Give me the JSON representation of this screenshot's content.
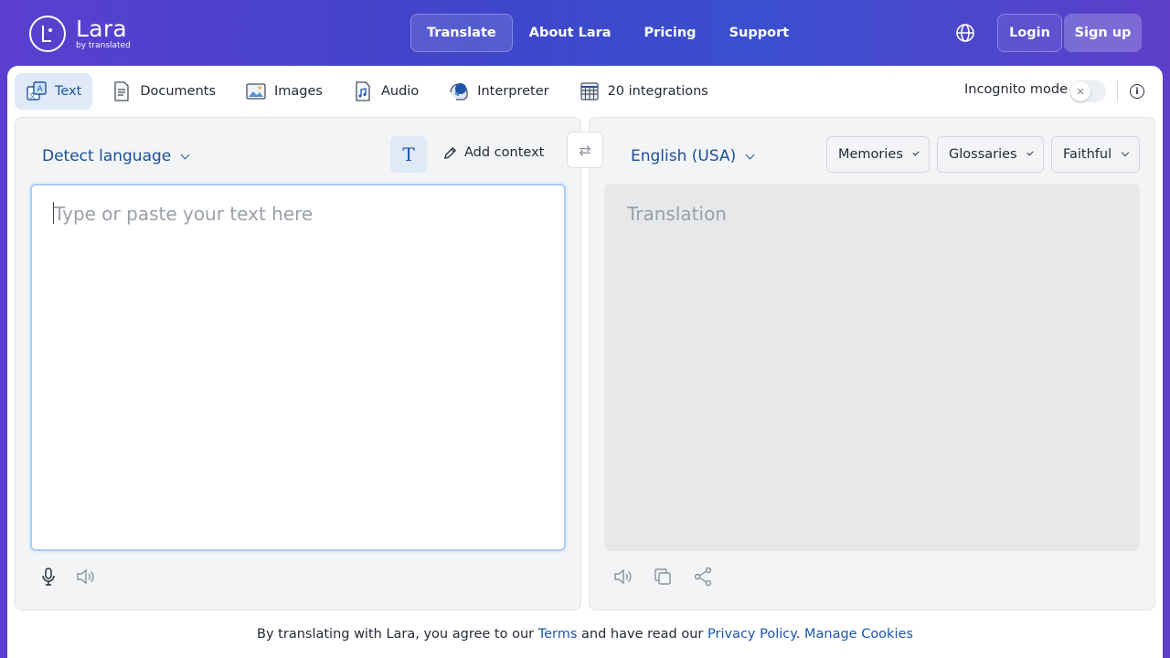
{
  "header": {
    "logo": {
      "name": "Lara",
      "sub": "by translated"
    },
    "nav": [
      {
        "label": "Translate",
        "active": true
      },
      {
        "label": "About Lara",
        "active": false
      },
      {
        "label": "Pricing",
        "active": false
      },
      {
        "label": "Support",
        "active": false
      }
    ],
    "login_label": "Login",
    "signup_label": "Sign up"
  },
  "tabs": [
    {
      "label": "Text",
      "icon": "text-translate-icon",
      "active": true
    },
    {
      "label": "Documents",
      "icon": "document-icon",
      "active": false
    },
    {
      "label": "Images",
      "icon": "image-icon",
      "active": false
    },
    {
      "label": "Audio",
      "icon": "audio-file-icon",
      "active": false
    },
    {
      "label": "Interpreter",
      "icon": "interpreter-icon",
      "active": false
    },
    {
      "label": "20 integrations",
      "icon": "integrations-grid-icon",
      "active": false
    }
  ],
  "incognito": {
    "label": "Incognito mode",
    "enabled": false
  },
  "source": {
    "language": "Detect language",
    "add_context_label": "Add context",
    "placeholder": "Type or paste your text here"
  },
  "target": {
    "language": "English (USA)",
    "placeholder": "Translation",
    "memories_label": "Memories",
    "glossaries_label": "Glossaries",
    "style_label": "Faithful"
  },
  "footer": {
    "prefix": "By translating with Lara, you agree to our ",
    "terms": "Terms",
    "middle": " and have read our ",
    "privacy": "Privacy Policy",
    "dot": ". ",
    "cookies": "Manage Cookies"
  },
  "colors": {
    "accent": "#1a4f9c",
    "link": "#1a56b0",
    "header_bg": "#3f46c9"
  }
}
